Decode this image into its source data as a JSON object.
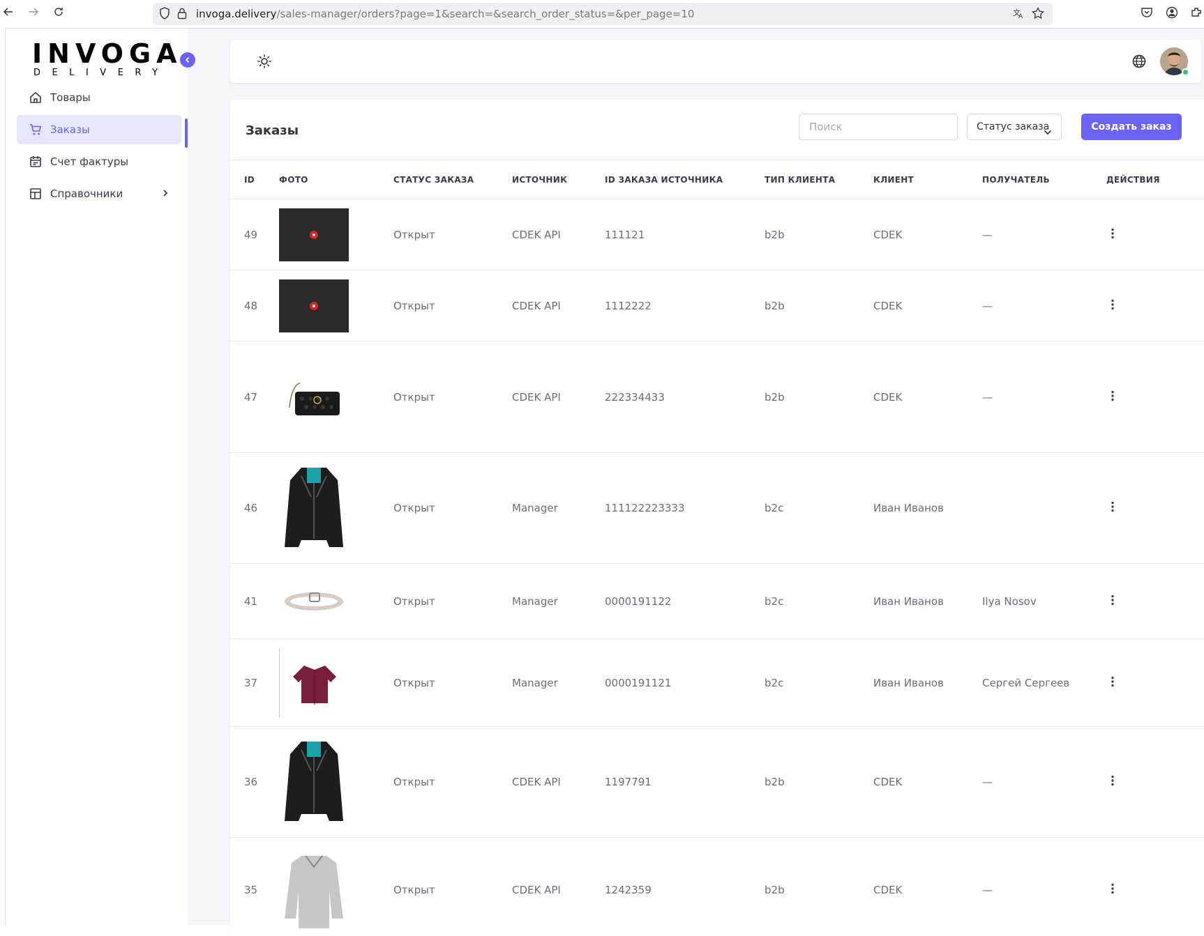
{
  "browser": {
    "url_host": "invoga.delivery",
    "url_path": "/sales-manager/orders?page=1&search=&search_order_status=&per_page=10"
  },
  "logo": {
    "main": "INVOGA",
    "sub": "DELIVERY"
  },
  "sidebar": {
    "items": [
      {
        "label": "Товары",
        "icon": "home-icon"
      },
      {
        "label": "Заказы",
        "icon": "cart-icon"
      },
      {
        "label": "Счет фактуры",
        "icon": "calendar-icon"
      },
      {
        "label": "Справочники",
        "icon": "layout-icon"
      }
    ]
  },
  "page": {
    "title": "Заказы",
    "search_placeholder": "Поиск",
    "status_filter": "Статус заказа",
    "create_button": "Создать заказ"
  },
  "table": {
    "headers": [
      "ID",
      "ФОТО",
      "СТАТУС ЗАКАЗА",
      "ИСТОЧНИК",
      "ID ЗАКАЗА ИСТОЧНИКА",
      "ТИП КЛИЕНТА",
      "КЛИЕНТ",
      "ПОЛУЧАТЕЛЬ",
      "ДЕЙСТВИЯ"
    ],
    "rows": [
      {
        "id": "49",
        "photo": "placeholder",
        "status": "Открыт",
        "source": "CDEK API",
        "source_id": "111121",
        "client_type": "b2b",
        "client": "CDEK",
        "recipient": "—"
      },
      {
        "id": "48",
        "photo": "placeholder",
        "status": "Открыт",
        "source": "CDEK API",
        "source_id": "1112222",
        "client_type": "b2b",
        "client": "CDEK",
        "recipient": "—"
      },
      {
        "id": "47",
        "photo": "bag",
        "status": "Открыт",
        "source": "CDEK API",
        "source_id": "222334433",
        "client_type": "b2b",
        "client": "CDEK",
        "recipient": "—"
      },
      {
        "id": "46",
        "photo": "jacket",
        "status": "Открыт",
        "source": "Manager",
        "source_id": "111122223333",
        "client_type": "b2c",
        "client": "Иван Иванов",
        "recipient": ""
      },
      {
        "id": "41",
        "photo": "belt",
        "status": "Открыт",
        "source": "Manager",
        "source_id": "0000191122",
        "client_type": "b2c",
        "client": "Иван Иванов",
        "recipient": "Ilya Nosov"
      },
      {
        "id": "37",
        "photo": "shirt",
        "status": "Открыт",
        "source": "Manager",
        "source_id": "0000191121",
        "client_type": "b2c",
        "client": "Иван Иванов",
        "recipient": "Сергей Сергеев"
      },
      {
        "id": "36",
        "photo": "jacket",
        "status": "Открыт",
        "source": "CDEK API",
        "source_id": "1197791",
        "client_type": "b2b",
        "client": "CDEK",
        "recipient": "—"
      },
      {
        "id": "35",
        "photo": "sweater",
        "status": "Открыт",
        "source": "CDEK API",
        "source_id": "1242359",
        "client_type": "b2b",
        "client": "CDEK",
        "recipient": "—"
      }
    ]
  },
  "colors": {
    "accent": "#6b63f5",
    "active_bg": "#e6e6fd",
    "online": "#37c36b"
  }
}
